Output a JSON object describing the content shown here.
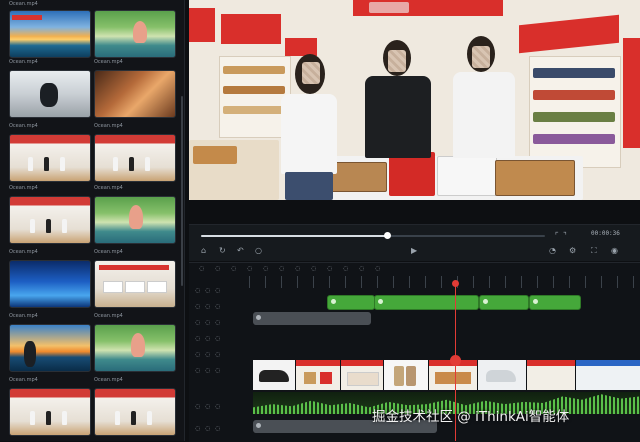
{
  "library": {
    "thumbnails": [
      {
        "caption": "Ocean.mp4",
        "kind": "sunset"
      },
      {
        "caption": "",
        "kind": "flamingo"
      },
      {
        "caption": "Ocean.mp4",
        "kind": "bw"
      },
      {
        "caption": "Ocean.mp4",
        "kind": "bread"
      },
      {
        "caption": "Ocean.mp4",
        "kind": "store"
      },
      {
        "caption": "Ocean.mp4",
        "kind": "store"
      },
      {
        "caption": "Ocean.mp4",
        "kind": "store"
      },
      {
        "caption": "Ocean.mp4",
        "kind": "flamingo"
      },
      {
        "caption": "Ocean.mp4",
        "kind": "blue"
      },
      {
        "caption": "Ocean.mp4",
        "kind": "desk"
      },
      {
        "caption": "Ocean.mp4",
        "kind": "sunset"
      },
      {
        "caption": "Ocean.mp4",
        "kind": "flamingo"
      },
      {
        "caption": "Ocean.mp4",
        "kind": "store"
      },
      {
        "caption": "Ocean.mp4",
        "kind": "store"
      }
    ]
  },
  "playback": {
    "progress": 0.54,
    "timecode": "00:00:36"
  },
  "timeline": {
    "green_clips": [
      {
        "label": ""
      },
      {
        "label": ""
      },
      {
        "label": ""
      },
      {
        "label": ""
      }
    ],
    "grey_clips": [
      {
        "label": ""
      },
      {
        "label": ""
      }
    ]
  },
  "watermark": "掘金技术社区 @ iThinkAi智能体",
  "colors": {
    "accent_green": "#45a83a",
    "playhead_red": "#e23b36",
    "store_red": "#d92f2b"
  }
}
